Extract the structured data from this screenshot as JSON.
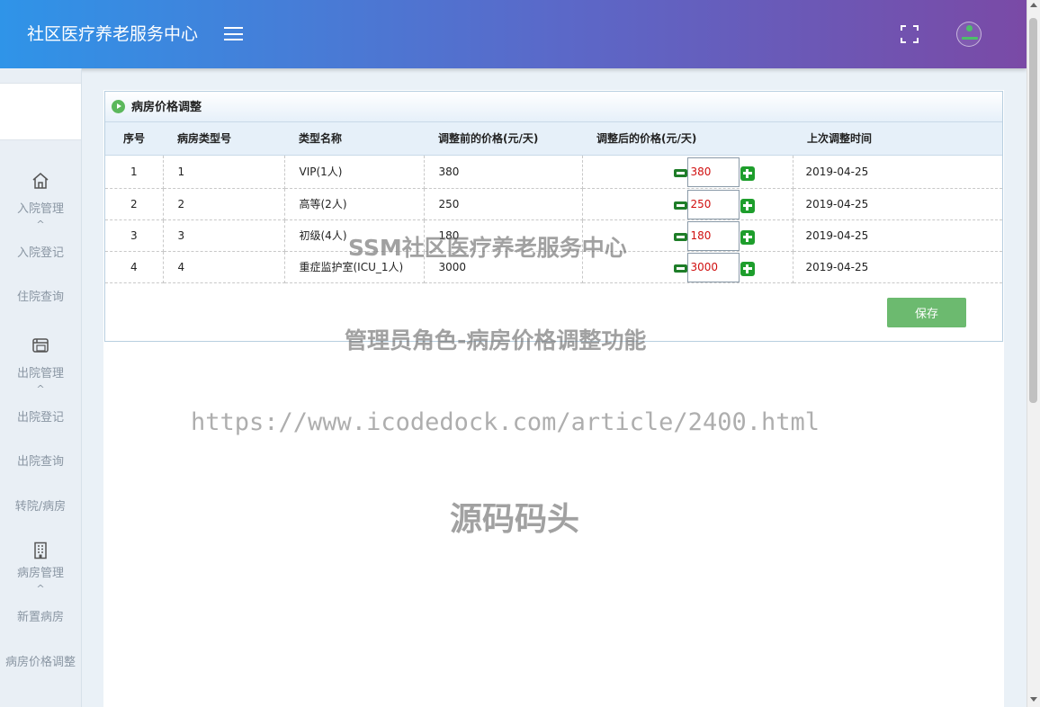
{
  "header": {
    "app_title": "社区医疗养老服务中心"
  },
  "sidebar": {
    "groups": [
      {
        "label": "入院管理",
        "icon": "home-icon",
        "items": [
          "入院登记",
          "住院查询"
        ]
      },
      {
        "label": "出院管理",
        "icon": "window-icon",
        "items": [
          "出院登记",
          "出院查询",
          "转院/病房"
        ]
      },
      {
        "label": "病房管理",
        "icon": "building-icon",
        "items": [
          "新置病房",
          "病房价格调整"
        ]
      }
    ],
    "caret": "^"
  },
  "panel": {
    "title": "病房价格调整",
    "columns": [
      "序号",
      "病房类型号",
      "类型名称",
      "调整前的价格(元/天)",
      "调整后的价格(元/天)",
      "上次调整时间"
    ],
    "rows": [
      {
        "no": "1",
        "type_id": "1",
        "type_name": "VIP(1人)",
        "old_price": "380",
        "new_price": "380",
        "last_time": "2019-04-25"
      },
      {
        "no": "2",
        "type_id": "2",
        "type_name": "高等(2人)",
        "old_price": "250",
        "new_price": "250",
        "last_time": "2019-04-25"
      },
      {
        "no": "3",
        "type_id": "3",
        "type_name": "初级(4人)",
        "old_price": "180",
        "new_price": "180",
        "last_time": "2019-04-25"
      },
      {
        "no": "4",
        "type_id": "4",
        "type_name": "重症监护室(ICU_1人)",
        "old_price": "3000",
        "new_price": "3000",
        "last_time": "2019-04-25"
      }
    ],
    "save_label": "保存"
  },
  "watermarks": {
    "line1": "SSM社区医疗养老服务中心",
    "line2": "管理员角色-病房价格调整功能",
    "line3": "https://www.icodedock.com/article/2400.html",
    "line4": "源码码头"
  }
}
